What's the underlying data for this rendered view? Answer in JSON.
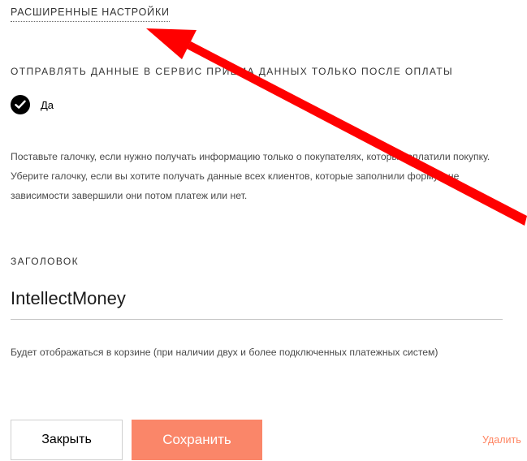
{
  "advanced_settings": {
    "link_label": "РАСШИРЕННЫЕ НАСТРОЙКИ"
  },
  "send_after_payment": {
    "label": "ОТПРАВЛЯТЬ ДАННЫЕ В СЕРВИС ПРИЕМА ДАННЫХ ТОЛЬКО ПОСЛЕ ОПЛАТЫ",
    "checked": true,
    "checkbox_label": "Да",
    "hint": "Поставьте галочку, если нужно получать информацию только о покупателях, которые оплатили покупку. Уберите галочку, если вы хотите получать данные всех клиентов, которые заполнили форму, вне зависимости завершили они потом платеж или нет."
  },
  "title_field": {
    "label": "ЗАГОЛОВОК",
    "value": "IntellectMoney",
    "hint": "Будет отображаться в корзине (при наличии двух и более подключенных платежных систем)"
  },
  "actions": {
    "close_label": "Закрыть",
    "save_label": "Сохранить",
    "delete_label": "Удалить"
  },
  "colors": {
    "save_button": "#fa8669",
    "delete_link": "#ff8562",
    "annotation_arrow": "#ff0000"
  },
  "icons": {
    "checkbox": "check-icon"
  }
}
